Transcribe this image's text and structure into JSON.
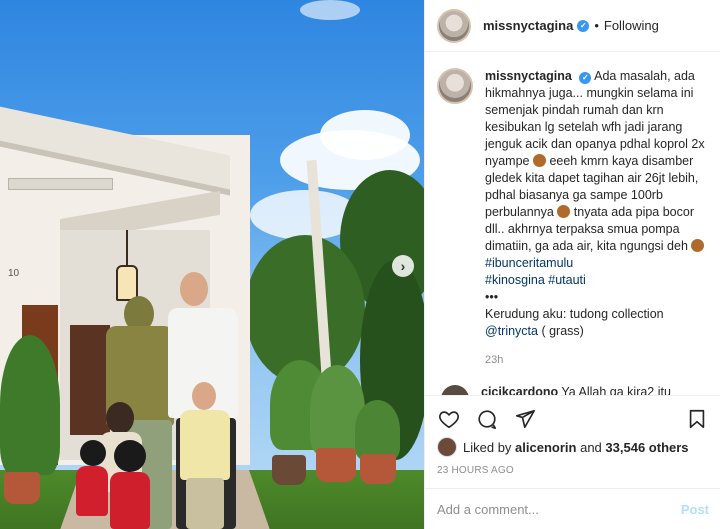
{
  "header": {
    "username": "missnyctagina",
    "separator": "•",
    "follow_status": "Following"
  },
  "caption": {
    "username": "missnyctagina",
    "text_1": "Ada masalah, ada hikmahnya juga... mungkin selama ini semenjak pindah rumah dan krn kesibukan lg setelah wfh jadi jarang jenguk acik dan opanya pdhal koprol 2x nyampe",
    "text_2": " eeeh kmrn kaya disamber gledek kita dapet tagihan air 26jt lebih, pdhal biasanya ga sampe 100rb perbulannya",
    "text_3": " tnyata ada pipa bocor dll.. akhrnya terpaksa smua pompa dimatiin, ga ada air, kita ngungsi deh",
    "hashtag_1": "#ibunceritamulu",
    "hashtag_2": "#kinosgina",
    "hashtag_3": "#utauti",
    "ellipsis": "•••",
    "credit_line": "Kerudung aku: tudong collection",
    "credit_mention": "@trinycta",
    "credit_tail": " ( grass)",
    "time": "23h"
  },
  "next_comment": {
    "username": "cicikcardono",
    "text": "Ya Allah ga kira2 itu"
  },
  "likes": {
    "prefix": "Liked by",
    "user": "alicenorin",
    "middle": "and",
    "count": "33,546 others"
  },
  "posted_ago": "23 HOURS AGO",
  "comment_box": {
    "placeholder": "Add a comment...",
    "post_label": "Post"
  },
  "photo": {
    "house_number": "10",
    "next_arrow": "›"
  },
  "icons": {
    "like": "heart-icon",
    "comment": "comment-bubble-icon",
    "share": "paper-plane-icon",
    "save": "bookmark-icon",
    "verified": "verified-badge-icon"
  },
  "colors": {
    "verified": "#3897f0",
    "link": "#00376b",
    "muted": "#8e8e8e",
    "post_disabled": "#b2dffc"
  }
}
